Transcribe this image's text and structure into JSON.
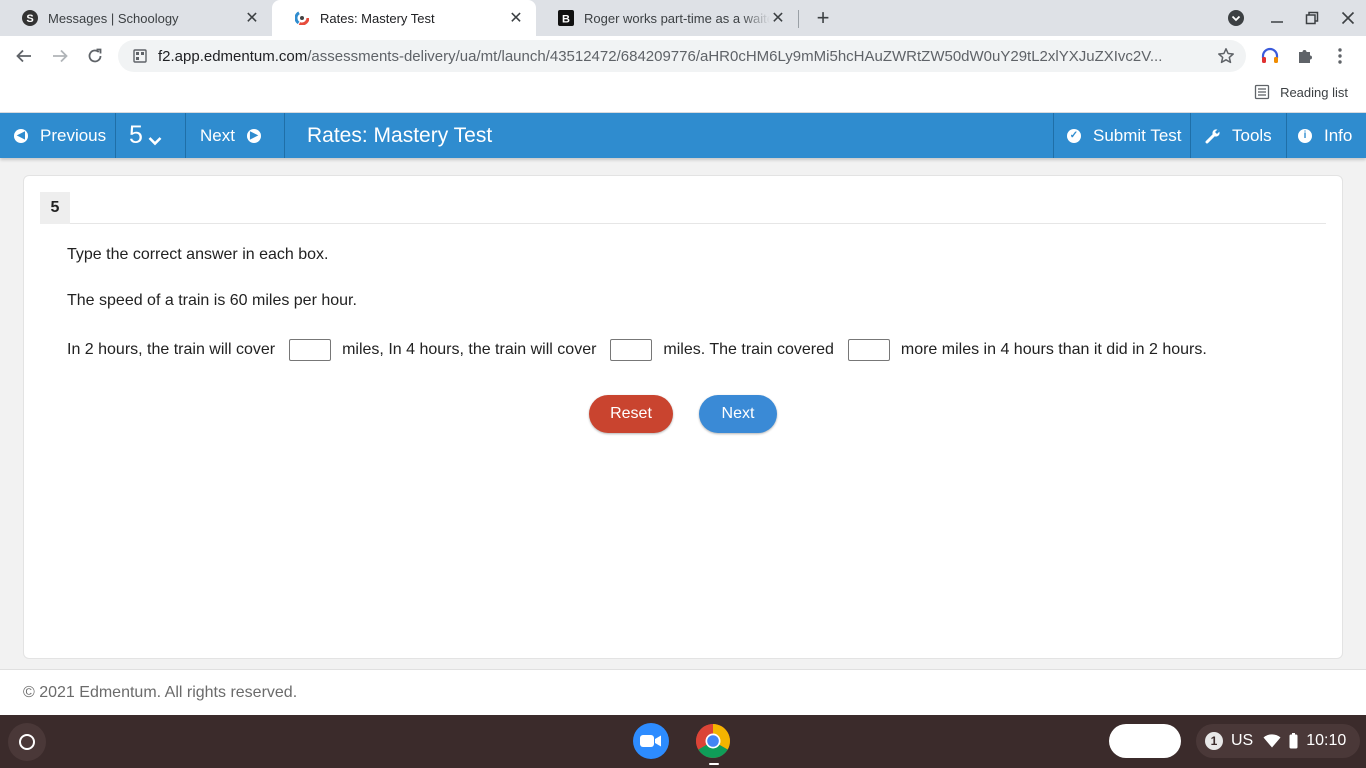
{
  "browser": {
    "tabs": [
      {
        "title": "Messages | Schoology",
        "active": false
      },
      {
        "title": "Rates: Mastery Test",
        "active": true
      },
      {
        "title": "Roger works part-time as a waiter",
        "active": false
      }
    ],
    "url_host": "f2.app.edmentum.com",
    "url_path": "/assessments-delivery/ua/mt/launch/43512472/684209776/aHR0cHM6Ly9mMi5hcHAuZWRtZW50dW0uY29tL2xlYXJuZXIvc2V...",
    "reading_list": "Reading list"
  },
  "header": {
    "previous_label": "Previous",
    "question_number": "5",
    "next_label": "Next",
    "test_title": "Rates: Mastery Test",
    "submit_label": "Submit Test",
    "tools_label": "Tools",
    "info_label": "Info",
    "bg_color": "#2f8ccf"
  },
  "question": {
    "number": "5",
    "instruction": "Type the correct answer in each box.",
    "speed_text": "The speed of a train is 60 miles per hour.",
    "sentence_part1": "In 2 hours, the train will cover",
    "sentence_part2": "miles, In 4 hours, the train will cover",
    "sentence_part3": "miles. The train covered",
    "sentence_part4": "more miles in 4 hours than it did in 2 hours.",
    "answers": [
      "",
      "",
      ""
    ],
    "reset_label": "Reset",
    "next_label": "Next",
    "reset_color": "#c9442f",
    "next_color": "#3a8ad6"
  },
  "footer": {
    "copyright": "© 2021 Edmentum. All rights reserved."
  },
  "shelf": {
    "notification_count": "1",
    "keyboard_lang": "US",
    "time": "10:10"
  }
}
